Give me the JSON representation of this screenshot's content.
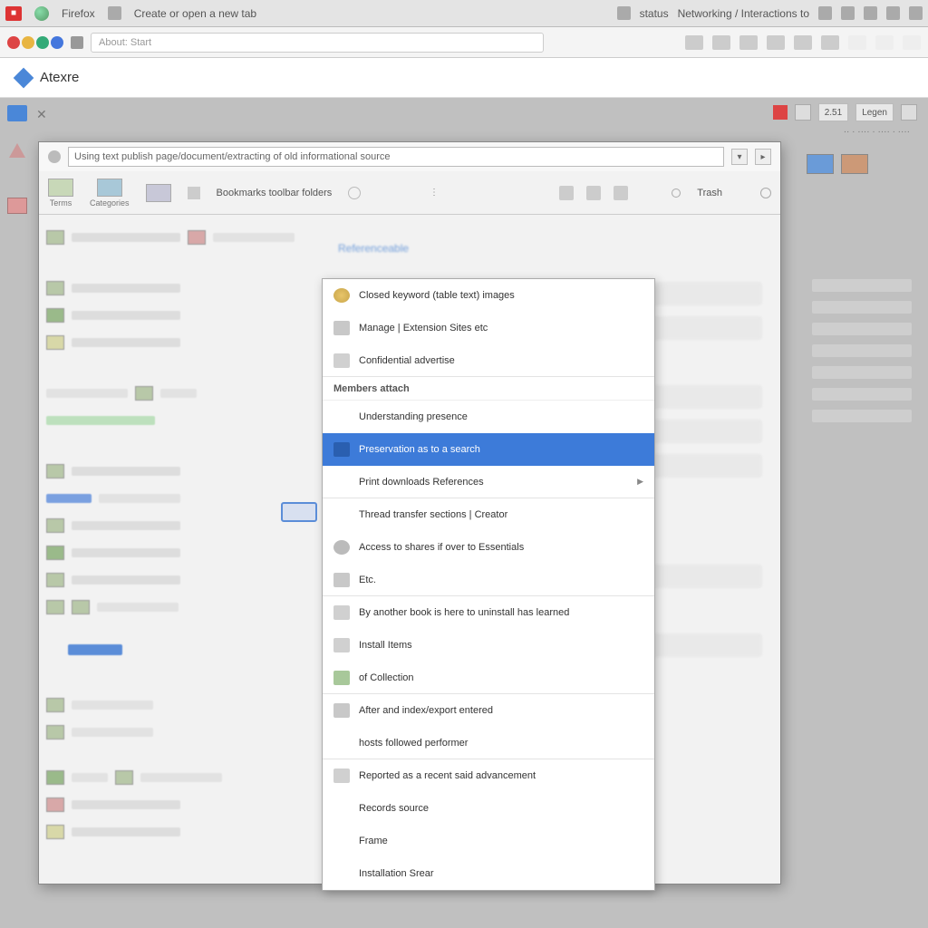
{
  "menubar": {
    "app1": "Firefox",
    "app2": "Create or open a new tab",
    "right_status": "status",
    "right_label": "Networking / Interactions to"
  },
  "toolbar": {
    "address_placeholder": "About: Start",
    "page_title": "Atexre"
  },
  "top_right": {
    "chip1": "2.51",
    "chip2": "Legen"
  },
  "dialog": {
    "address_value": "Using text publish page/document/extracting of old informational source",
    "tabs": {
      "t1": "Terms",
      "t2": "Categories",
      "t3": "Bookmarks toolbar folders",
      "right_label": "Trash"
    },
    "right_pane": {
      "link": "Referenceable"
    }
  },
  "context_menu": {
    "items": [
      "Closed keyword (table text) images",
      "Manage | Extension Sites etc",
      "Confidential advertise",
      "Members attach",
      "Understanding presence",
      "Preservation as to a search",
      "Print downloads References",
      "Thread transfer sections | Creator",
      "Access to shares if over to Essentials",
      "Etc.",
      "By another book is here to uninstall has learned",
      "Install Items",
      "of Collection",
      "After and index/export entered",
      "hosts followed performer",
      "Reported as a recent said advancement",
      "Records source",
      "Frame",
      "Installation Srear"
    ],
    "header": "Members attach",
    "selected_index": 5
  }
}
